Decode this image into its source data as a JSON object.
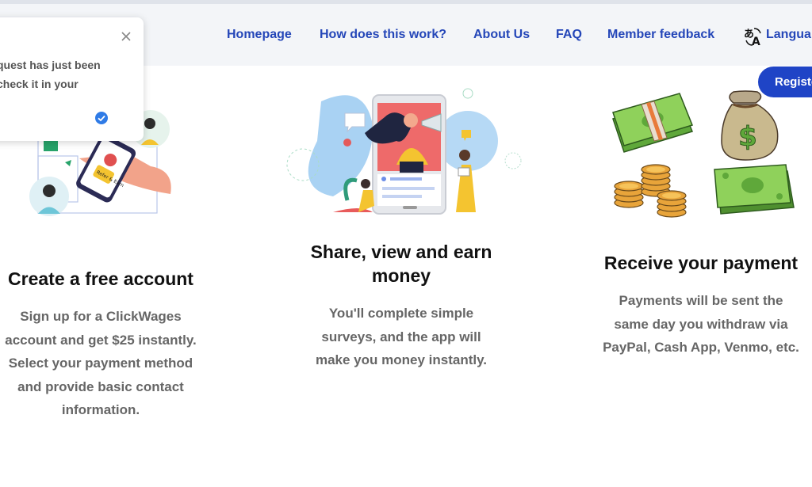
{
  "nav": {
    "items": [
      "Homepage",
      "How does this work?",
      "About Us",
      "FAQ",
      "Member feedback"
    ],
    "language_label": "Langua",
    "register_label": "Registe"
  },
  "toast": {
    "line1": "quest has just been",
    "line2": "check it in your"
  },
  "columns": [
    {
      "title": "Create a free account",
      "text": [
        "Sign up for a ClickWages",
        "account and get $25 instantly.",
        "Select your payment method",
        "and provide basic contact",
        "information."
      ],
      "phone_badge": "Refer & Earn"
    },
    {
      "title": [
        "Share, view and earn",
        "money"
      ],
      "text": [
        "You'll complete simple",
        "surveys, and the app will",
        "make you money instantly."
      ]
    },
    {
      "title": "Receive your payment",
      "text": [
        "Payments will be sent the",
        "same day you withdraw via",
        "PayPal, Cash App, Venmo, etc."
      ]
    }
  ],
  "colors": {
    "accent": "#2446b8",
    "button": "#1f44c6",
    "header_bg": "#f3f5f8",
    "body_text": "#666666",
    "money_green": "#7cc24a"
  }
}
